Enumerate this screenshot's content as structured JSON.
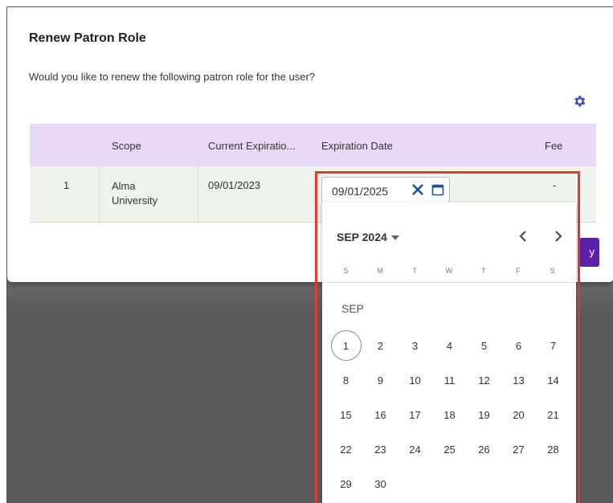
{
  "dialog": {
    "title": "Renew Patron Role",
    "subtitle": "Would you like to renew the following patron role for the user?",
    "gear_icon": "gear-icon",
    "apply_label": "y"
  },
  "table": {
    "headers": {
      "scope": "Scope",
      "current_expiration": "Current Expiratio...",
      "expiration_date": "Expiration Date",
      "fee": "Fee"
    },
    "row": {
      "num": "1",
      "scope": "Alma University",
      "current_expiration": "09/01/2023",
      "fee": "-"
    }
  },
  "date_input": {
    "value": "09/01/2025",
    "clear_icon": "close-icon",
    "calendar_icon": "calendar-icon"
  },
  "calendar": {
    "month_label": "SEP 2024",
    "section_label": "SEP",
    "weekdays": [
      "S",
      "M",
      "T",
      "W",
      "T",
      "F",
      "S"
    ],
    "weeks": [
      [
        "1",
        "2",
        "3",
        "4",
        "5",
        "6",
        "7"
      ],
      [
        "8",
        "9",
        "10",
        "11",
        "12",
        "13",
        "14"
      ],
      [
        "15",
        "16",
        "17",
        "18",
        "19",
        "20",
        "21"
      ],
      [
        "22",
        "23",
        "24",
        "25",
        "26",
        "27",
        "28"
      ],
      [
        "29",
        "30",
        "",
        "",
        "",
        "",
        ""
      ]
    ],
    "today": "1"
  },
  "colors": {
    "header_bg": "#ead9f6",
    "row_bg": "#eef4ec",
    "accent": "#5b1fa8",
    "gear": "#3f51b5",
    "highlight": "#e53935"
  }
}
